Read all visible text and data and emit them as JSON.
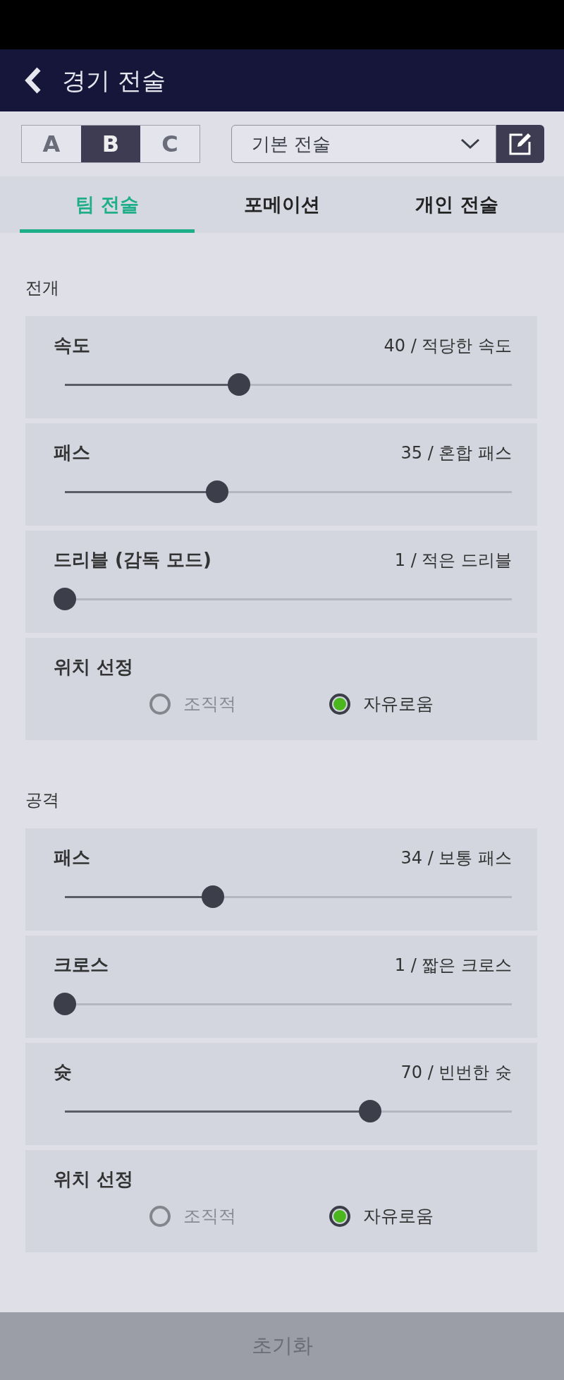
{
  "header": {
    "title": "경기 전술"
  },
  "slots": [
    {
      "label": "A",
      "selected": false
    },
    {
      "label": "B",
      "selected": true
    },
    {
      "label": "C",
      "selected": false
    }
  ],
  "preset": {
    "value": "기본 전술"
  },
  "tabs": [
    {
      "label": "팀 전술",
      "selected": true
    },
    {
      "label": "포메이션",
      "selected": false
    },
    {
      "label": "개인 전술",
      "selected": false
    }
  ],
  "sections": [
    {
      "title": "전개",
      "settings": [
        {
          "kind": "slider",
          "label": "속도",
          "reading": "40 / 적당한 속도",
          "level": 0.4
        },
        {
          "kind": "slider",
          "label": "패스",
          "reading": "35 / 혼합 패스",
          "level": 0.35
        },
        {
          "kind": "slider",
          "label": "드리블 (감독 모드)",
          "reading": "1 / 적은 드리블",
          "level": 0
        },
        {
          "kind": "radio",
          "label": "위치 선정",
          "options": [
            {
              "label": "조직적",
              "selected": false
            },
            {
              "label": "자유로움",
              "selected": true
            }
          ]
        }
      ]
    },
    {
      "title": "공격",
      "settings": [
        {
          "kind": "slider",
          "label": "패스",
          "reading": "34 / 보통 패스",
          "level": 0.34
        },
        {
          "kind": "slider",
          "label": "크로스",
          "reading": "1 / 짧은 크로스",
          "level": 0
        },
        {
          "kind": "slider",
          "label": "슛",
          "reading": "70 / 빈번한 슛",
          "level": 0.7
        },
        {
          "kind": "radio",
          "label": "위치 선정",
          "options": [
            {
              "label": "조직적",
              "selected": false
            },
            {
              "label": "자유로움",
              "selected": true
            }
          ]
        }
      ]
    }
  ],
  "footer_button": "초기화"
}
